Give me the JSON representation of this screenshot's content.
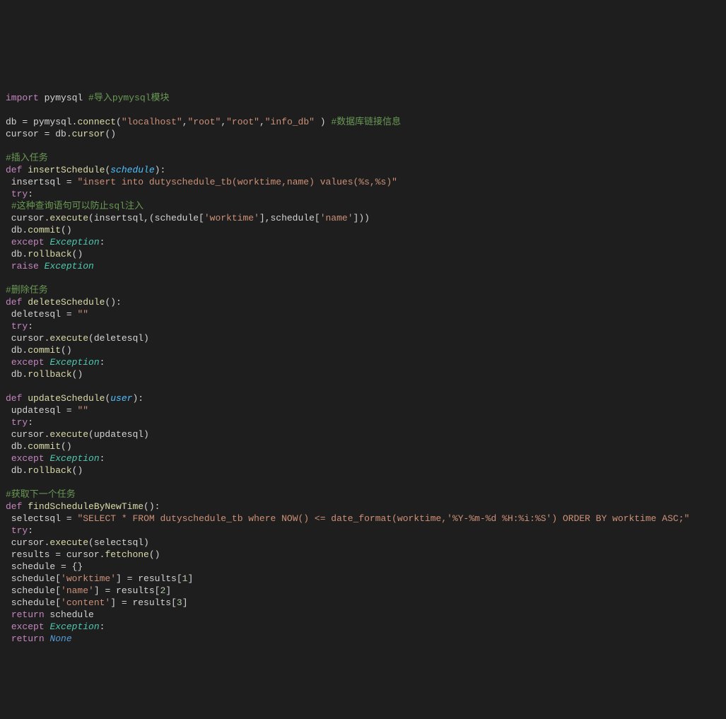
{
  "code": {
    "l0": [
      [
        "keyword",
        "import"
      ],
      [
        "plain",
        " pymysql "
      ],
      [
        "comment",
        "#导入pymysql模块"
      ]
    ],
    "l1": [],
    "l2": [
      [
        "plain",
        "db "
      ],
      [
        "op",
        "="
      ],
      [
        "plain",
        " pymysql."
      ],
      [
        "func",
        "connect"
      ],
      [
        "plain",
        "("
      ],
      [
        "string",
        "\"localhost\""
      ],
      [
        "plain",
        ","
      ],
      [
        "string",
        "\"root\""
      ],
      [
        "plain",
        ","
      ],
      [
        "string",
        "\"root\""
      ],
      [
        "plain",
        ","
      ],
      [
        "string",
        "\"info_db\""
      ],
      [
        "plain",
        " ) "
      ],
      [
        "comment",
        "#数据库链接信息"
      ]
    ],
    "l3": [
      [
        "plain",
        "cursor "
      ],
      [
        "op",
        "="
      ],
      [
        "plain",
        " db."
      ],
      [
        "func",
        "cursor"
      ],
      [
        "plain",
        "()"
      ]
    ],
    "l4": [],
    "l5": [
      [
        "comment",
        "#插入任务"
      ]
    ],
    "l6": [
      [
        "keyword",
        "def"
      ],
      [
        "plain",
        " "
      ],
      [
        "func",
        "insertSchedule"
      ],
      [
        "plain",
        "("
      ],
      [
        "param",
        "schedule"
      ],
      [
        "plain",
        "):"
      ]
    ],
    "l7": [
      [
        "plain",
        " insertsql "
      ],
      [
        "op",
        "="
      ],
      [
        "plain",
        " "
      ],
      [
        "string",
        "\"insert into dutyschedule_tb(worktime,name) values(%s,%s)\""
      ]
    ],
    "l8": [
      [
        "plain",
        " "
      ],
      [
        "keyword",
        "try"
      ],
      [
        "plain",
        ":"
      ]
    ],
    "l9": [
      [
        "plain",
        " "
      ],
      [
        "comment",
        "#这种查询语句可以防止sql注入"
      ]
    ],
    "l10": [
      [
        "plain",
        " cursor."
      ],
      [
        "func",
        "execute"
      ],
      [
        "plain",
        "(insertsql,(schedule["
      ],
      [
        "string",
        "'worktime'"
      ],
      [
        "plain",
        "],schedule["
      ],
      [
        "string",
        "'name'"
      ],
      [
        "plain",
        "]))"
      ]
    ],
    "l11": [
      [
        "plain",
        " db."
      ],
      [
        "func",
        "commit"
      ],
      [
        "plain",
        "()"
      ]
    ],
    "l12": [
      [
        "plain",
        " "
      ],
      [
        "keyword",
        "except"
      ],
      [
        "plain",
        " "
      ],
      [
        "class",
        "Exception"
      ],
      [
        "plain",
        ":"
      ]
    ],
    "l13": [
      [
        "plain",
        " db."
      ],
      [
        "func",
        "rollback"
      ],
      [
        "plain",
        "()"
      ]
    ],
    "l14": [
      [
        "plain",
        " "
      ],
      [
        "keyword",
        "raise"
      ],
      [
        "plain",
        " "
      ],
      [
        "class",
        "Exception"
      ]
    ],
    "l15": [],
    "l16": [
      [
        "comment",
        "#删除任务"
      ]
    ],
    "l17": [
      [
        "keyword",
        "def"
      ],
      [
        "plain",
        " "
      ],
      [
        "func",
        "deleteSchedule"
      ],
      [
        "plain",
        "():"
      ]
    ],
    "l18": [
      [
        "plain",
        " deletesql "
      ],
      [
        "op",
        "="
      ],
      [
        "plain",
        " "
      ],
      [
        "string",
        "\"\""
      ]
    ],
    "l19": [
      [
        "plain",
        " "
      ],
      [
        "keyword",
        "try"
      ],
      [
        "plain",
        ":"
      ]
    ],
    "l20": [
      [
        "plain",
        " cursor."
      ],
      [
        "func",
        "execute"
      ],
      [
        "plain",
        "(deletesql)"
      ]
    ],
    "l21": [
      [
        "plain",
        " db."
      ],
      [
        "func",
        "commit"
      ],
      [
        "plain",
        "()"
      ]
    ],
    "l22": [
      [
        "plain",
        " "
      ],
      [
        "keyword",
        "except"
      ],
      [
        "plain",
        " "
      ],
      [
        "class",
        "Exception"
      ],
      [
        "plain",
        ":"
      ]
    ],
    "l23": [
      [
        "plain",
        " db."
      ],
      [
        "func",
        "rollback"
      ],
      [
        "plain",
        "()"
      ]
    ],
    "l24": [],
    "l25": [
      [
        "keyword",
        "def"
      ],
      [
        "plain",
        " "
      ],
      [
        "func",
        "updateSchedule"
      ],
      [
        "plain",
        "("
      ],
      [
        "param",
        "user"
      ],
      [
        "plain",
        "):"
      ]
    ],
    "l26": [
      [
        "plain",
        " updatesql "
      ],
      [
        "op",
        "="
      ],
      [
        "plain",
        " "
      ],
      [
        "string",
        "\"\""
      ]
    ],
    "l27": [
      [
        "plain",
        " "
      ],
      [
        "keyword",
        "try"
      ],
      [
        "plain",
        ":"
      ]
    ],
    "l28": [
      [
        "plain",
        " cursor."
      ],
      [
        "func",
        "execute"
      ],
      [
        "plain",
        "(updatesql)"
      ]
    ],
    "l29": [
      [
        "plain",
        " db."
      ],
      [
        "func",
        "commit"
      ],
      [
        "plain",
        "()"
      ]
    ],
    "l30": [
      [
        "plain",
        " "
      ],
      [
        "keyword",
        "except"
      ],
      [
        "plain",
        " "
      ],
      [
        "class",
        "Exception"
      ],
      [
        "plain",
        ":"
      ]
    ],
    "l31": [
      [
        "plain",
        " db."
      ],
      [
        "func",
        "rollback"
      ],
      [
        "plain",
        "()"
      ]
    ],
    "l32": [],
    "l33": [
      [
        "comment",
        "#获取下一个任务"
      ]
    ],
    "l34": [
      [
        "keyword",
        "def"
      ],
      [
        "plain",
        " "
      ],
      [
        "func",
        "findScheduleByNewTime"
      ],
      [
        "plain",
        "():"
      ]
    ],
    "l35": [
      [
        "plain",
        " selectsql "
      ],
      [
        "op",
        "="
      ],
      [
        "plain",
        " "
      ],
      [
        "string",
        "\"SELECT * FROM dutyschedule_tb where NOW() <= date_format(worktime,'%Y-%m-%d %H:%i:%S') ORDER BY worktime ASC;\""
      ]
    ],
    "l36": [
      [
        "plain",
        " "
      ],
      [
        "keyword",
        "try"
      ],
      [
        "plain",
        ":"
      ]
    ],
    "l37": [
      [
        "plain",
        " cursor."
      ],
      [
        "func",
        "execute"
      ],
      [
        "plain",
        "(selectsql)"
      ]
    ],
    "l38": [
      [
        "plain",
        " results "
      ],
      [
        "op",
        "="
      ],
      [
        "plain",
        " cursor."
      ],
      [
        "func",
        "fetchone"
      ],
      [
        "plain",
        "()"
      ]
    ],
    "l39": [
      [
        "plain",
        " schedule "
      ],
      [
        "op",
        "="
      ],
      [
        "plain",
        " {}"
      ]
    ],
    "l40": [
      [
        "plain",
        " schedule["
      ],
      [
        "string",
        "'worktime'"
      ],
      [
        "plain",
        "] "
      ],
      [
        "op",
        "="
      ],
      [
        "plain",
        " results["
      ],
      [
        "num",
        "1"
      ],
      [
        "plain",
        "]"
      ]
    ],
    "l41": [
      [
        "plain",
        " schedule["
      ],
      [
        "string",
        "'name'"
      ],
      [
        "plain",
        "] "
      ],
      [
        "op",
        "="
      ],
      [
        "plain",
        " results["
      ],
      [
        "num",
        "2"
      ],
      [
        "plain",
        "]"
      ]
    ],
    "l42": [
      [
        "plain",
        " schedule["
      ],
      [
        "string",
        "'content'"
      ],
      [
        "plain",
        "] "
      ],
      [
        "op",
        "="
      ],
      [
        "plain",
        " results["
      ],
      [
        "num",
        "3"
      ],
      [
        "plain",
        "]"
      ]
    ],
    "l43": [
      [
        "plain",
        " "
      ],
      [
        "keyword",
        "return"
      ],
      [
        "plain",
        " schedule"
      ]
    ],
    "l44": [
      [
        "plain",
        " "
      ],
      [
        "keyword",
        "except"
      ],
      [
        "plain",
        " "
      ],
      [
        "class",
        "Exception"
      ],
      [
        "plain",
        ":"
      ]
    ],
    "l45": [
      [
        "plain",
        " "
      ],
      [
        "keyword",
        "return"
      ],
      [
        "plain",
        " "
      ],
      [
        "const",
        "None"
      ]
    ]
  },
  "line_order": [
    "l0",
    "l1",
    "l2",
    "l3",
    "l4",
    "l5",
    "l6",
    "l7",
    "l8",
    "l9",
    "l10",
    "l11",
    "l12",
    "l13",
    "l14",
    "l15",
    "l16",
    "l17",
    "l18",
    "l19",
    "l20",
    "l21",
    "l22",
    "l23",
    "l24",
    "l25",
    "l26",
    "l27",
    "l28",
    "l29",
    "l30",
    "l31",
    "l32",
    "l33",
    "l34",
    "l35",
    "l36",
    "l37",
    "l38",
    "l39",
    "l40",
    "l41",
    "l42",
    "l43",
    "l44",
    "l45"
  ]
}
